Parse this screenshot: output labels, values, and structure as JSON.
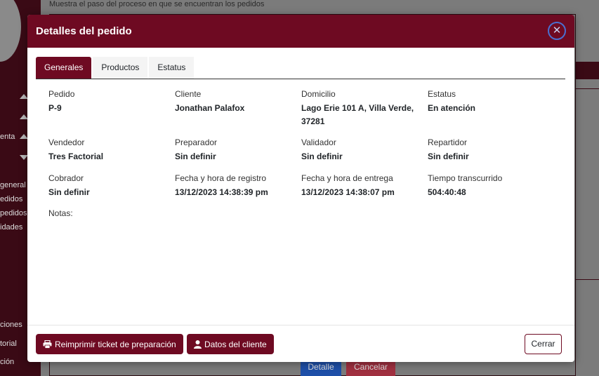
{
  "background": {
    "subtitle": "Muestra el paso del proceso en que se encuentran los pedidos",
    "sidebar_items": [
      "enta",
      "general",
      "edidos",
      "pedidos",
      "idades",
      "ciones",
      "torial",
      "ción"
    ],
    "buttons": [
      "Detalle",
      "Cancelar"
    ]
  },
  "modal": {
    "title": "Detalles del pedido",
    "close_glyph": "✕",
    "tabs": [
      "Generales",
      "Productos",
      "Estatus"
    ],
    "fields": {
      "pedido": {
        "label": "Pedido",
        "value": "P-9"
      },
      "cliente": {
        "label": "Cliente",
        "value": "Jonathan Palafox"
      },
      "domicilio": {
        "label": "Domicilio",
        "value_line1": "Lago Erie 101 A, Villa Verde,",
        "value_line2": "37281"
      },
      "estatus": {
        "label": "Estatus",
        "value": "En atención"
      },
      "vendedor": {
        "label": "Vendedor",
        "value": "Tres Factorial"
      },
      "preparador": {
        "label": "Preparador",
        "value": "Sin definir"
      },
      "validador": {
        "label": "Validador",
        "value": "Sin definir"
      },
      "repartidor": {
        "label": "Repartidor",
        "value": "Sin definir"
      },
      "cobrador": {
        "label": "Cobrador",
        "value": "Sin definir"
      },
      "registro": {
        "label": "Fecha y hora de registro",
        "value": "13/12/2023 14:38:39 pm"
      },
      "entrega": {
        "label": "Fecha y hora de entrega",
        "value": "13/12/2023 14:38:07 pm"
      },
      "tiempo": {
        "label": "Tiempo transcurrido",
        "value": "504:40:48"
      },
      "notas": {
        "label": "Notas:"
      }
    },
    "footer": {
      "reprint_label": "Reimprimir ticket de preparación",
      "client_label": "Datos del cliente",
      "close_label": "Cerrar"
    }
  },
  "colors": {
    "brand": "#6e0a22",
    "close_ring": "#4a6fd0",
    "bg_detail_button": "#1e4fa8",
    "bg_cancel_button": "#a03040"
  }
}
